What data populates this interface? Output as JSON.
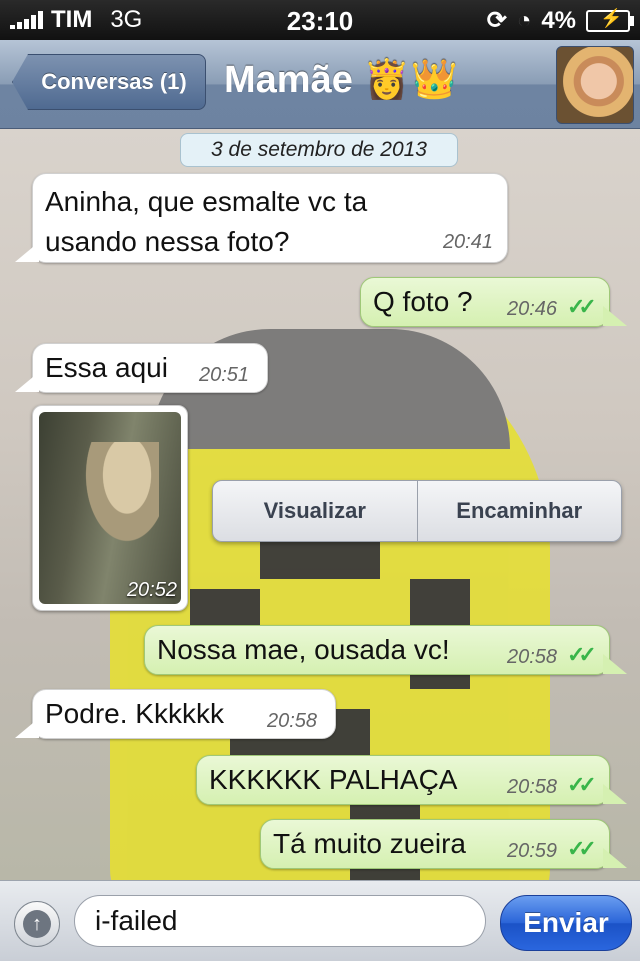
{
  "status_bar": {
    "carrier": "TIM",
    "network": "3G",
    "time": "23:10",
    "battery": "4%"
  },
  "nav": {
    "back_label": "Conversas (1)",
    "title": "Mamãe 👸👑"
  },
  "chat": {
    "date_chip": "3 de setembro de 2013",
    "messages": [
      {
        "text": "Aninha, que esmalte vc ta\nusando nessa foto?",
        "time": "20:41"
      },
      {
        "text": "Q foto ?",
        "time": "20:46",
        "ticks": "✓✓"
      },
      {
        "text": "Essa aqui",
        "time": "20:51"
      },
      {
        "text": "Nossa mae, ousada vc!",
        "time": "20:58",
        "ticks": "✓✓"
      },
      {
        "text": "Podre. Kkkkkk",
        "time": "20:58"
      },
      {
        "text": "KKKKKK PALHAÇA",
        "time": "20:58",
        "ticks": "✓✓"
      },
      {
        "text": "Tá muito zueira",
        "time": "20:59",
        "ticks": "✓✓"
      }
    ],
    "photo_time": "20:52",
    "actions": {
      "view": "Visualizar",
      "forward": "Encaminhar"
    }
  },
  "input": {
    "value": "i-failed",
    "send_label": "Enviar"
  },
  "colors": {
    "outgoing_bubble": "#d5f0b1",
    "incoming_bubble": "#ffffff",
    "read_ticks": "#39b54a",
    "send_button": "#2a64d8"
  }
}
